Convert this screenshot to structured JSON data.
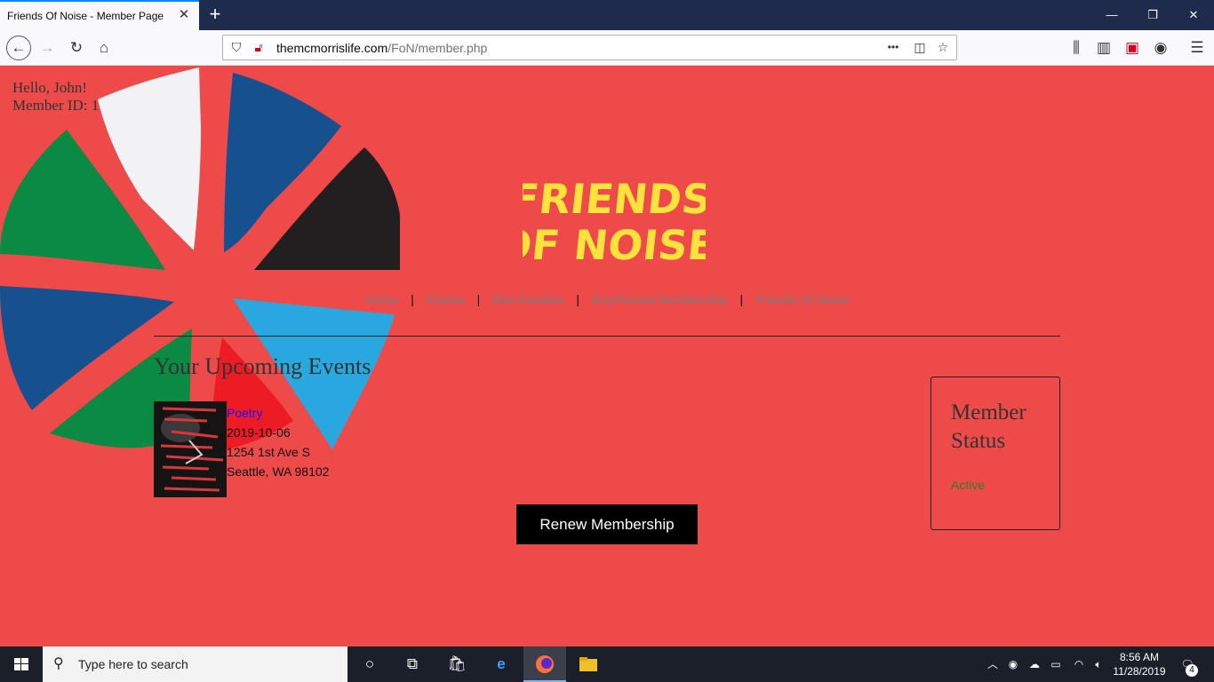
{
  "browser": {
    "tab_title": "Friends Of Noise - Member Page",
    "tab_close": "✕",
    "new_tab": "+",
    "url_host": "themcmorrislife.com",
    "url_path": "/FoN/member.php",
    "url_more": "•••",
    "win_minimize": "—",
    "win_restore": "❐",
    "win_close": "✕"
  },
  "page": {
    "greeting": "Hello, John!",
    "member_id": "Member ID: 1",
    "logo_line1": "FRIENDS",
    "logo_line2": "OF NOISE",
    "nav": [
      {
        "label": "Home"
      },
      {
        "label": "Events"
      },
      {
        "label": "Merchandise"
      },
      {
        "label": "Buy/Renew Membership"
      },
      {
        "label": "Friends Of Noise"
      }
    ],
    "nav_separator": "|",
    "upcoming_title": "Your Upcoming Events",
    "event": {
      "name": "Poetry",
      "date": "2019-10-06",
      "address1": "1254 1st Ave S",
      "address2": "Seattle, WA 98102"
    },
    "renew_button": "Renew Membership",
    "status_title": "Member Status",
    "status_value": "Active"
  },
  "taskbar": {
    "search_placeholder": "Type here to search",
    "time": "8:56 AM",
    "date": "11/28/2019",
    "notification_count": "4"
  },
  "colors": {
    "page_bg": "#ee4a4a",
    "logo_yellow": "#ffe23b",
    "blob_blue": "#17508e",
    "blob_green": "#0b8a44",
    "blob_white": "#f2f2f4",
    "blob_black": "#231f20",
    "blob_cyan": "#29a8e0",
    "blob_red": "#ed1c24",
    "status_green": "#2e7d32"
  }
}
